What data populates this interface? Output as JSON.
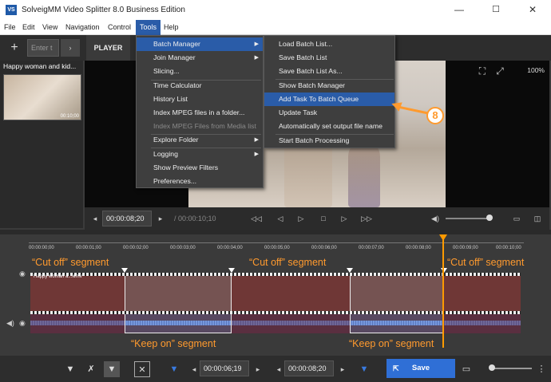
{
  "window": {
    "title": "SolveigMM Video Splitter 8.0 Business Edition",
    "icon": "VS",
    "min": "—",
    "max": "☐",
    "close": "✕"
  },
  "menubar": [
    "File",
    "Edit",
    "View",
    "Navigation",
    "Control",
    "Tools",
    "Help"
  ],
  "toolbar": {
    "add": "+",
    "search_placeholder": "Enter t",
    "nav": "›",
    "player_tab": "PLAYER"
  },
  "media": {
    "clip_name": "Happy woman and kid...",
    "thumb_time": "00:10;00"
  },
  "video": {
    "zoom": "100%"
  },
  "controls": {
    "current_time": "00:00:08;20",
    "total_time": "/ 00:00:10;10"
  },
  "tools_menu": [
    {
      "label": "Batch Manager",
      "sub": true,
      "hl": true
    },
    {
      "label": "Join Manager",
      "sub": true
    },
    {
      "label": "Slicing..."
    },
    {
      "label": "Time Calculator"
    },
    {
      "label": "History List"
    },
    {
      "label": "Index MPEG files in a folder..."
    },
    {
      "label": "Index MPEG Files from Media list",
      "disabled": true
    },
    {
      "label": "Explore Folder",
      "sub": true
    },
    {
      "label": "Logging",
      "sub": true
    },
    {
      "label": "Show Preview Filters"
    },
    {
      "label": "Preferences..."
    }
  ],
  "batch_submenu": [
    "Load Batch List...",
    "Save Batch List",
    "Save Batch List As...",
    "Show Batch Manager",
    "Add Task To Batch Queue",
    "Update Task",
    "Automatically set output file name",
    "Start Batch Processing"
  ],
  "step_number": "8",
  "ruler_ticks": [
    "00:00:00;00",
    "00:00:01;00",
    "00:00:02;00",
    "00:00:03;00",
    "00:00:04;00",
    "00:00:05;00",
    "00:00:06;00",
    "00:00:07;00",
    "00:00:08;00",
    "00:00:09;00",
    "00:00:10;00"
  ],
  "track_clip_label": "Happy woman a...wmv",
  "annotations": {
    "cut1": "“Cut off” segment",
    "cut2": "“Cut off” segment",
    "cut3": "“Cut off” segment",
    "keep1": "“Keep on” segment",
    "keep2": "“Keep on” segment"
  },
  "bottom": {
    "time1": "00:00:06;19",
    "time2": "00:00:08;20",
    "save": "Save"
  },
  "colors": {
    "accent": "#2a5ca8",
    "annotation": "#ff9a2e",
    "save": "#2f6fd6"
  }
}
